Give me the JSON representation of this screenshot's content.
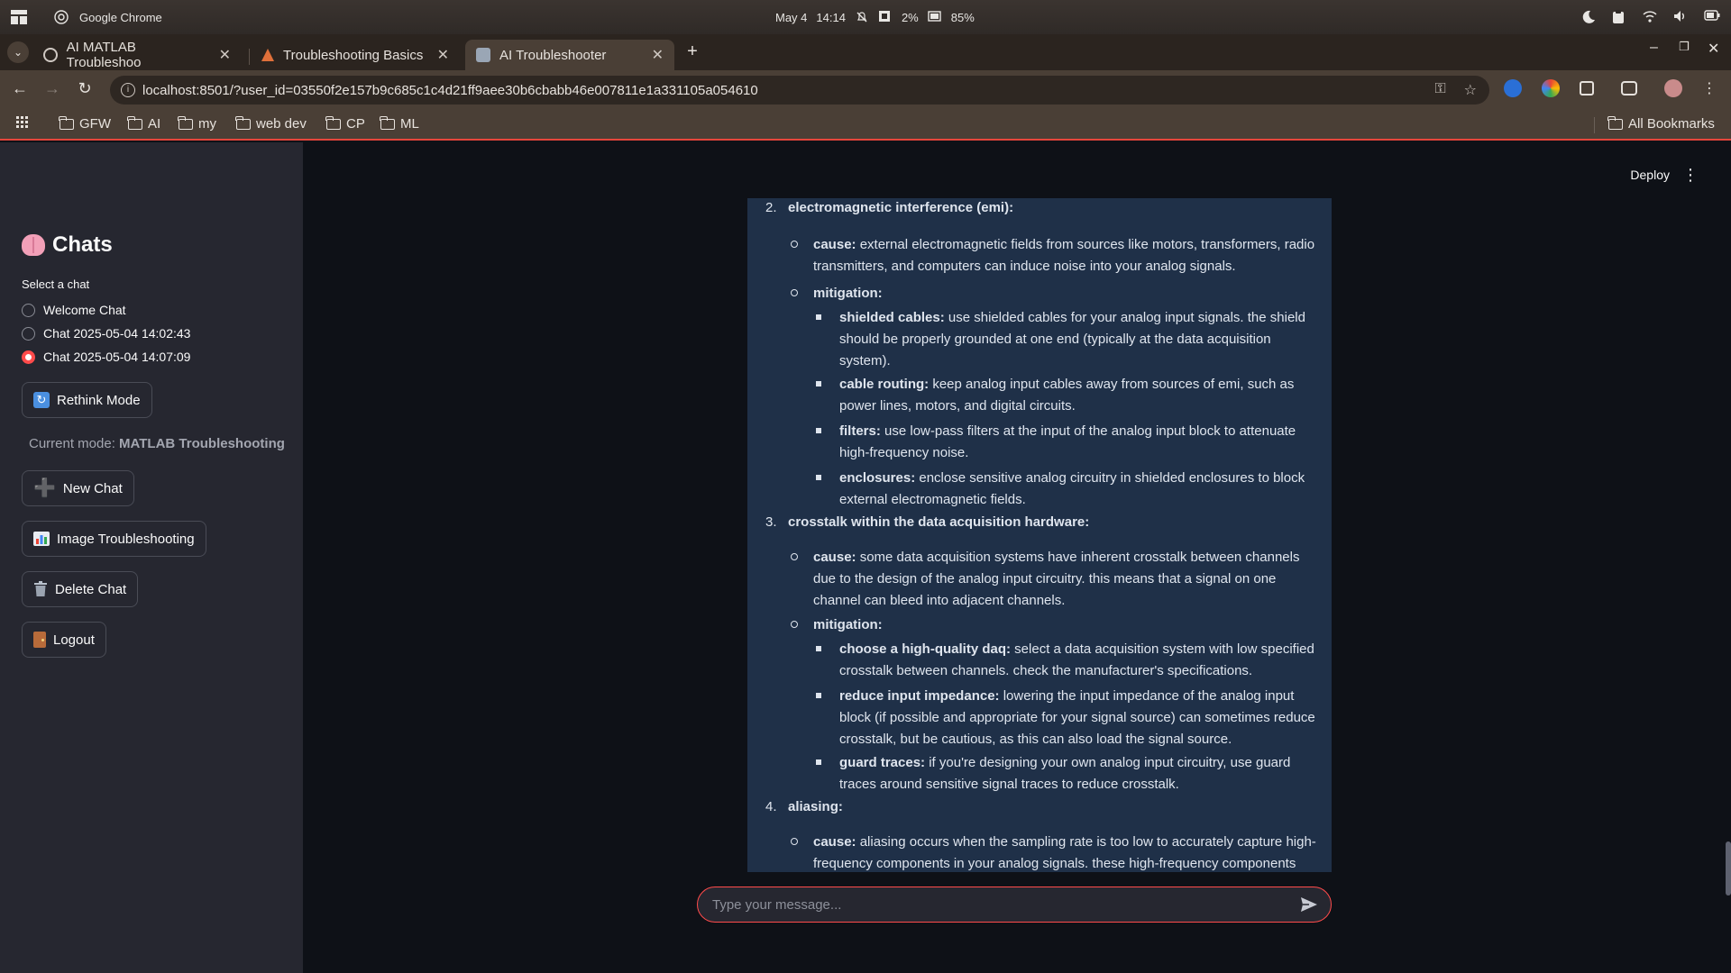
{
  "os": {
    "app_name": "Google Chrome",
    "date": "May 4",
    "time": "14:14",
    "cpu": "2%",
    "battery": "85%"
  },
  "browser": {
    "tabs": [
      {
        "label": "AI MATLAB Troubleshoo",
        "active": false
      },
      {
        "label": "Troubleshooting Basics",
        "active": false
      },
      {
        "label": "AI Troubleshooter",
        "active": true
      }
    ],
    "url": "localhost:8501/?user_id=03550f2e157b9c685c1c4d21ff9aee30b6cbabb46e007811e1a331105a054610",
    "bookmarks": [
      "GFW",
      "AI",
      "my",
      "web dev",
      "CP",
      "ML"
    ],
    "all_bookmarks": "All Bookmarks"
  },
  "sidebar": {
    "title": "Chats",
    "title_icon": "brain-emoji",
    "select_label": "Select a chat",
    "chats": [
      {
        "label": "Welcome Chat",
        "selected": false
      },
      {
        "label": "Chat 2025-05-04 14:02:43",
        "selected": false
      },
      {
        "label": "Chat 2025-05-04 14:07:09",
        "selected": true
      }
    ],
    "rethink_label": "Rethink Mode",
    "mode_prefix": "Current mode: ",
    "mode_value": "MATLAB Troubleshooting",
    "new_chat_label": "New Chat",
    "image_label": "Image Troubleshooting",
    "delete_label": "Delete Chat",
    "logout_label": "Logout"
  },
  "header": {
    "deploy_label": "Deploy"
  },
  "message": {
    "s2_num": "2.",
    "s2_title": "electromagnetic interference (emi):",
    "s2_cause_label": "cause:",
    "s2_cause_l1": " external electromagnetic fields from sources like motors, transformers, radio",
    "s2_cause_l2": "transmitters, and computers can induce noise into your analog signals.",
    "s2_mit_label": "mitigation:",
    "s2_b1_label": "shielded cables:",
    "s2_b1_l1": " use shielded cables for your analog input signals. the shield",
    "s2_b1_l2": "should be properly grounded at one end (typically at the data acquisition",
    "s2_b1_l3": "system).",
    "s2_b2_label": "cable routing:",
    "s2_b2_l1": " keep analog input cables away from sources of emi, such as",
    "s2_b2_l2": "power lines, motors, and digital circuits.",
    "s2_b3_label": "filters:",
    "s2_b3_l1": " use low-pass filters at the input of the analog input block to attenuate",
    "s2_b3_l2": "high-frequency noise.",
    "s2_b4_label": "enclosures:",
    "s2_b4_l1": " enclose sensitive analog circuitry in shielded enclosures to block",
    "s2_b4_l2": "external electromagnetic fields.",
    "s3_num": "3.",
    "s3_title": "crosstalk within the data acquisition hardware:",
    "s3_cause_label": "cause:",
    "s3_cause_l1": " some data acquisition systems have inherent crosstalk between channels",
    "s3_cause_l2": "due to the design of the analog input circuitry. this means that a signal on one",
    "s3_cause_l3": "channel can bleed into adjacent channels.",
    "s3_mit_label": "mitigation:",
    "s3_b1_label": "choose a high-quality daq:",
    "s3_b1_l1": " select a data acquisition system with low specified",
    "s3_b1_l2": "crosstalk between channels. check the manufacturer's specifications.",
    "s3_b2_label": "reduce input impedance:",
    "s3_b2_l1": " lowering the input impedance of the analog input",
    "s3_b2_l2": "block (if possible and appropriate for your signal source) can sometimes reduce",
    "s3_b2_l3": "crosstalk, but be cautious, as this can also load the signal source.",
    "s3_b3_label": "guard traces:",
    "s3_b3_l1": " if you're designing your own analog input circuitry, use guard",
    "s3_b3_l2": "traces around sensitive signal traces to reduce crosstalk.",
    "s4_num": "4.",
    "s4_title": "aliasing:",
    "s4_cause_label": "cause:",
    "s4_cause_l1": " aliasing occurs when the sampling rate is too low to accurately capture high-",
    "s4_cause_l2": "frequency components in your analog signals. these high-frequency components"
  },
  "chat_input": {
    "placeholder": "Type your message..."
  },
  "colors": {
    "accent": "#ff4b4b",
    "sidebar_bg": "#262730",
    "main_bg": "#0e1117",
    "message_bg": "#1f3048"
  }
}
